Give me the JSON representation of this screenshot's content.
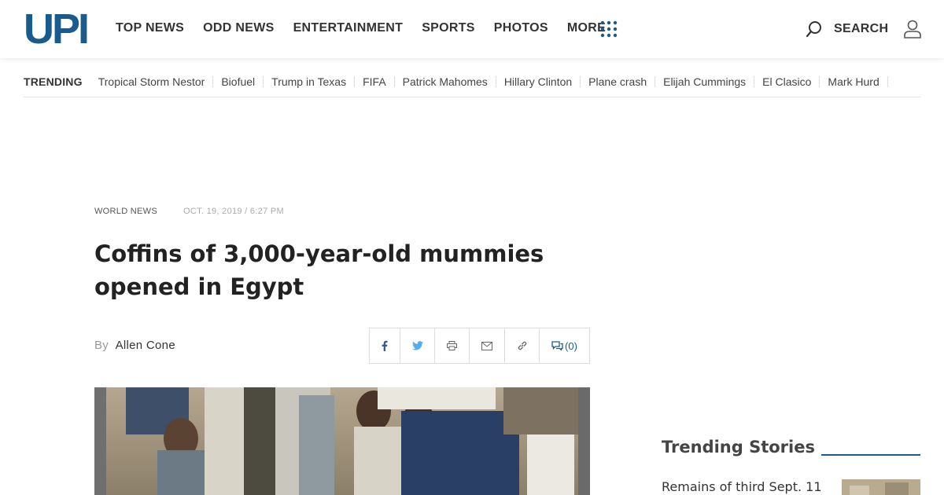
{
  "header": {
    "logo": "UPI",
    "nav": [
      "TOP NEWS",
      "ODD NEWS",
      "ENTERTAINMENT",
      "SPORTS",
      "PHOTOS",
      "MORE"
    ],
    "search_label": "SEARCH",
    "brand_color": "#1a5b8e"
  },
  "trending": {
    "label": "TRENDING",
    "items": [
      "Tropical Storm Nestor",
      "Biofuel",
      "Trump in Texas",
      "FIFA",
      "Patrick Mahomes",
      "Hillary Clinton",
      "Plane crash",
      "Elijah Cummings",
      "El Clasico",
      "Mark Hurd"
    ]
  },
  "article": {
    "category": "WORLD NEWS",
    "date": "OCT. 19, 2019 / 6:27 PM",
    "headline": "Coffins of 3,000-year-old mummies opened in Egypt",
    "by_label": "By",
    "author": "Allen Cone",
    "comments": "(0)"
  },
  "share_icons": [
    "facebook-icon",
    "twitter-icon",
    "print-icon",
    "email-icon",
    "link-icon",
    "comments-icon"
  ],
  "sidebar": {
    "title": "Trending Stories",
    "first_story": "Remains of third Sept. 11"
  }
}
